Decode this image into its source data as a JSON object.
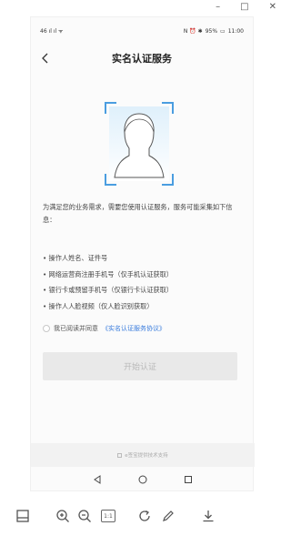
{
  "viewer": {
    "minimize": "–",
    "maximize": "□",
    "close": "✕"
  },
  "status_bar": {
    "carrier": "46 ıl ıl ᯤ",
    "indicators": "N ⏰ ✱",
    "battery": "95%",
    "time": "11:00"
  },
  "nav": {
    "title": "实名认证服务"
  },
  "content": {
    "description": "为满足您的业务需求，需要您使用认证服务，服务可能采集如下信息：",
    "items": [
      "• 操作人姓名、证件号",
      "• 网络运营商注册手机号（仅手机认证获取）",
      "• 银行卡或预留手机号（仅银行卡认证获取）",
      "• 操作人人脸视频（仅人脸识别获取）"
    ],
    "agree_prefix": "我已阅读并同意",
    "agree_link": "《实名认证服务协议》",
    "start_button": "开始认证",
    "footer_tip": "e签宝提供技术支持"
  },
  "accent_color": "#3b7ddd"
}
